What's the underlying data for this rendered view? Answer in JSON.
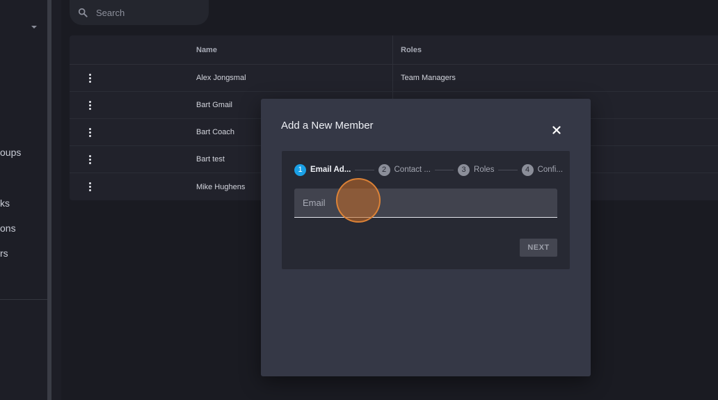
{
  "sidebar": {
    "nav_fragments": [
      "oups",
      "ks",
      "ons",
      "rs"
    ]
  },
  "search": {
    "placeholder": "Search"
  },
  "table": {
    "columns": [
      "Name",
      "Roles"
    ],
    "rows": [
      {
        "name": "Alex Jongsmal",
        "roles": "Team Managers"
      },
      {
        "name": "Bart Gmail",
        "roles": ""
      },
      {
        "name": "Bart Coach",
        "roles": ""
      },
      {
        "name": "Bart test",
        "roles": ""
      },
      {
        "name": "Mike Hughens",
        "roles": ""
      }
    ]
  },
  "modal": {
    "title": "Add a New Member",
    "steps": [
      {
        "number": "1",
        "label": "Email Ad...",
        "state": "active"
      },
      {
        "number": "2",
        "label": "Contact ...",
        "state": "inactive"
      },
      {
        "number": "3",
        "label": "Roles",
        "state": "inactive"
      },
      {
        "number": "4",
        "label": "Confi...",
        "state": "inactive"
      }
    ],
    "email_placeholder": "Email",
    "email_value": "",
    "next_label": "NEXT"
  },
  "colors": {
    "accent": "#1aa0e6",
    "modal_bg": "#353846",
    "page_bg": "#1a1b22",
    "click_marker": "#e68737"
  },
  "icons": {
    "search": "search-icon",
    "close": "close-icon",
    "row_menu": "more-vertical-icon",
    "dropdown": "chevron-down-icon"
  }
}
